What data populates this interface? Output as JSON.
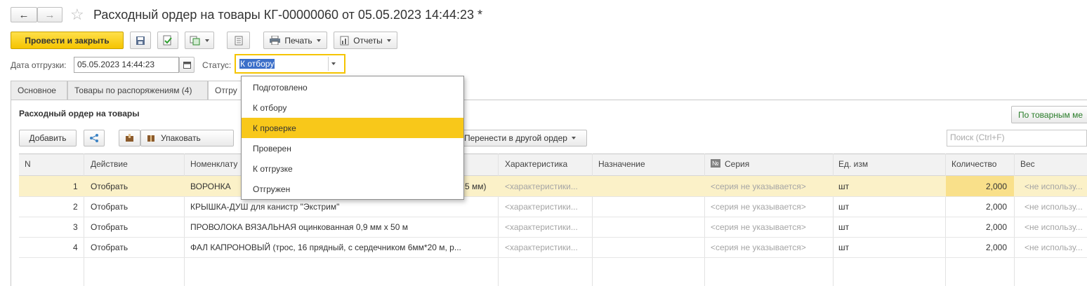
{
  "window": {
    "title": "Расходный ордер на товары КГ-00000060 от 05.05.2023 14:44:23 *",
    "star_icon": "star-icon"
  },
  "toolbar": {
    "post_close_label": "Провести и закрыть",
    "print_label": "Печать",
    "reports_label": "Отчеты"
  },
  "header": {
    "ship_date_label": "Дата отгрузки:",
    "ship_date_value": "05.05.2023 14:44:23",
    "status_label": "Статус:",
    "status_value": "К отбору"
  },
  "tabs": [
    {
      "label": "Основное"
    },
    {
      "label": "Товары по распоряжениям (4)"
    },
    {
      "label": "Отгру"
    }
  ],
  "section": {
    "title": "Расходный ордер на товары",
    "by_goods_button": "По товарным ме"
  },
  "table_toolbar": {
    "add_label": "Добавить",
    "pack_label": "Упаковать",
    "move_label": "Перенести в другой ордер",
    "search_placeholder": "Поиск (Ctrl+F)"
  },
  "columns": [
    "N",
    "Действие",
    "Номенклату",
    "Характеристика",
    "Назначение",
    "Серия",
    "Ед. изм",
    "Количество",
    "Вес"
  ],
  "series_badge": "№",
  "rows": [
    {
      "n": "1",
      "action": "Отобрать",
      "item": "ВОРОНКА",
      "item_tail": "5 мм)",
      "char": "<характеристики...",
      "purpose": "",
      "series": "<серия не указывается>",
      "unit": "шт",
      "qty": "2,000",
      "weight": "<не использу..."
    },
    {
      "n": "2",
      "action": "Отобрать",
      "item": "КРЫШКА-ДУШ для канистр \"Экстрим\"",
      "item_tail": "",
      "char": "<характеристики...",
      "purpose": "",
      "series": "<серия не указывается>",
      "unit": "шт",
      "qty": "2,000",
      "weight": "<не использу..."
    },
    {
      "n": "3",
      "action": "Отобрать",
      "item": "ПРОВОЛОКА ВЯЗАЛЬНАЯ оцинкованная 0,9 мм х 50 м",
      "item_tail": "",
      "char": "<характеристики...",
      "purpose": "",
      "series": "<серия не указывается>",
      "unit": "шт",
      "qty": "2,000",
      "weight": "<не использу..."
    },
    {
      "n": "4",
      "action": "Отобрать",
      "item": "ФАЛ КАПРОНОВЫЙ (трос, 16 прядный, с сердечником  6мм*20 м, р...",
      "item_tail": "",
      "char": "<характеристики...",
      "purpose": "",
      "series": "<серия не указывается>",
      "unit": "шт",
      "qty": "2,000",
      "weight": "<не использу..."
    }
  ],
  "status_options": [
    {
      "label": "Подготовлено"
    },
    {
      "label": "К отбору"
    },
    {
      "label": "К проверке"
    },
    {
      "label": "Проверен"
    },
    {
      "label": "К отгрузке"
    },
    {
      "label": "Отгружен"
    }
  ],
  "colors": {
    "accent_yellow": "#f8c81a",
    "selected_row": "#fbf1c8",
    "status_selection": "#3b6fc9",
    "green_link": "#2a7d2a"
  }
}
